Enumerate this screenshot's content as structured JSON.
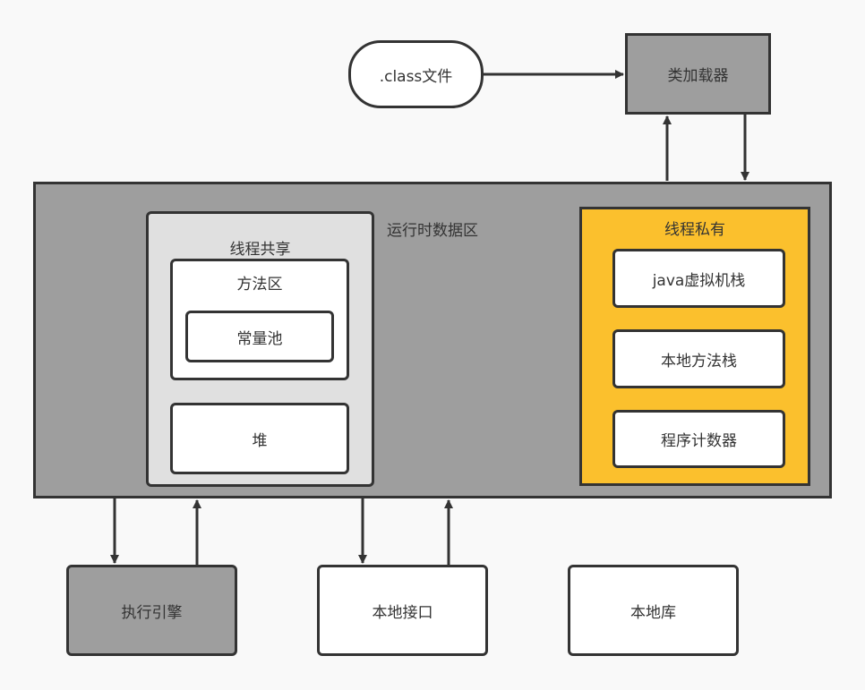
{
  "nodes": {
    "class_file": ".class文件",
    "class_loader": "类加载器",
    "runtime_area": "运行时数据区",
    "thread_shared": "线程共享",
    "method_area": "方法区",
    "constant_pool": "常量池",
    "heap": "堆",
    "thread_private": "线程私有",
    "jvm_stack": "java虚拟机栈",
    "native_method_stack": "本地方法栈",
    "program_counter": "程序计数器",
    "execution_engine": "执行引擎",
    "native_interface": "本地接口",
    "native_library": "本地库"
  },
  "colors": {
    "gray": "#9e9e9e",
    "shared": "#e0e0e0",
    "private": "#fbc02d",
    "border": "#333333"
  }
}
